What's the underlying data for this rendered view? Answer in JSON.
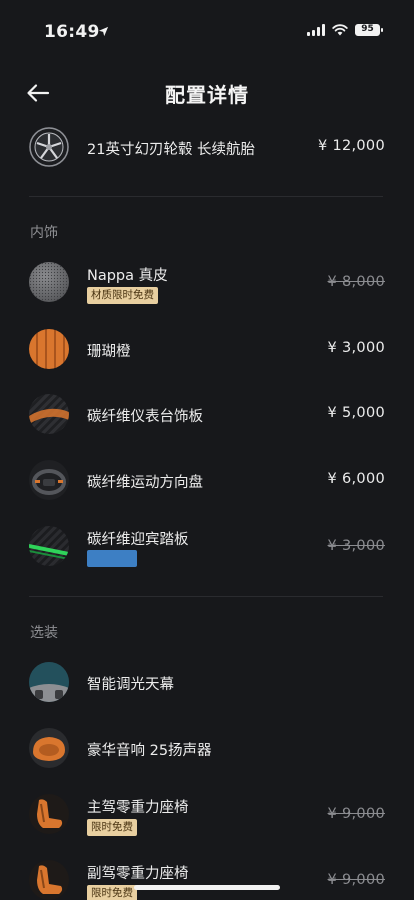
{
  "status_bar": {
    "time": "16:49",
    "battery": "95"
  },
  "header": {
    "title": "配置详情"
  },
  "items_top": [
    {
      "name": "21英寸幻刃轮毂 长续航胎",
      "price": "¥ 12,000"
    }
  ],
  "sections": {
    "interior": {
      "label": "内饰",
      "items": [
        {
          "name": "Nappa 真皮",
          "tag": "材质限时免费",
          "price": "¥ 8,000"
        },
        {
          "name": "珊瑚橙",
          "price": "¥ 3,000"
        },
        {
          "name": "碳纤维仪表台饰板",
          "price": "¥ 5,000"
        },
        {
          "name": "碳纤维运动方向盘",
          "price": "¥ 6,000"
        },
        {
          "name": "碳纤维迎宾踏板",
          "price": "¥ 3,000"
        }
      ]
    },
    "options": {
      "label": "选装",
      "items": [
        {
          "name": "智能调光天幕"
        },
        {
          "name": "豪华音响 25扬声器"
        },
        {
          "name": "主驾零重力座椅",
          "tag": "限时免费",
          "price": "¥ 9,000"
        },
        {
          "name": "副驾零重力座椅",
          "tag": "限时免费",
          "price": "¥ 9,000"
        }
      ]
    }
  },
  "colors": {
    "background": "#17181b",
    "tag_gold": "#e8cfa0",
    "tag_blue": "#3d7fc4",
    "accent_orange": "#d9762e"
  }
}
